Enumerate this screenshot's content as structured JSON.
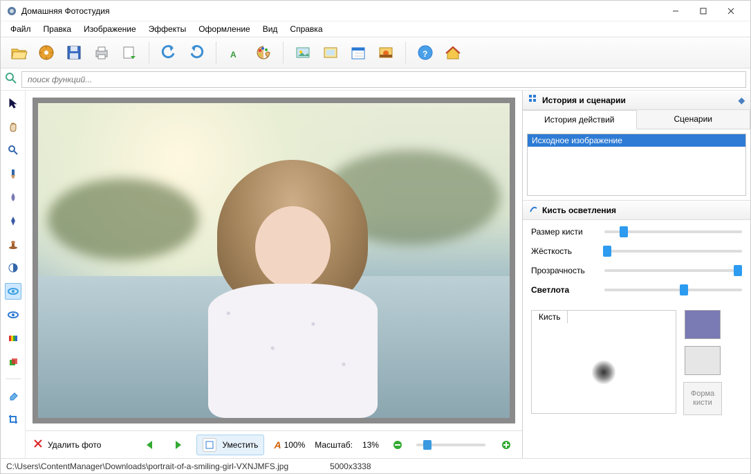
{
  "app": {
    "title": "Домашняя Фотостудия"
  },
  "menu": {
    "items": [
      "Файл",
      "Правка",
      "Изображение",
      "Эффекты",
      "Оформление",
      "Вид",
      "Справка"
    ]
  },
  "search": {
    "placeholder": "поиск функций..."
  },
  "history_panel": {
    "title": "История и сценарии",
    "tabs": [
      "История действий",
      "Сценарии"
    ],
    "active_tab": 0,
    "items": [
      "Исходное изображение"
    ]
  },
  "brush_panel": {
    "title": "Кисть осветления",
    "sliders": [
      {
        "label": "Размер кисти",
        "pos": 14
      },
      {
        "label": "Жёсткость",
        "pos": 2
      },
      {
        "label": "Прозрачность",
        "pos": 97
      },
      {
        "label": "Светлота",
        "pos": 58,
        "bold": true
      }
    ],
    "preview_label": "Кисть",
    "swatch_color": "#7a7ab5",
    "shape_button": "Форма\nкисти"
  },
  "bottom": {
    "delete": "Удалить фото",
    "fit": "Уместить",
    "full": "100%",
    "scale_label": "Масштаб:",
    "scale_value": "13%"
  },
  "status": {
    "path": "C:\\Users\\ContentManager\\Downloads\\portrait-of-a-smiling-girl-VXNJMFS.jpg",
    "dims": "5000x3338"
  },
  "toolbar_icons": [
    "open",
    "catalog",
    "save",
    "print",
    "export",
    "sep",
    "undo",
    "redo",
    "sep",
    "text",
    "palette",
    "sep",
    "image",
    "frame",
    "calendar",
    "sunset",
    "sep",
    "help",
    "home"
  ],
  "tool_icons": [
    "pointer",
    "hand",
    "zoom",
    "brush",
    "drop",
    "pen",
    "stamp",
    "contrast",
    "eye",
    "eye2",
    "gradient",
    "layer",
    "sep",
    "eraser",
    "crop"
  ]
}
